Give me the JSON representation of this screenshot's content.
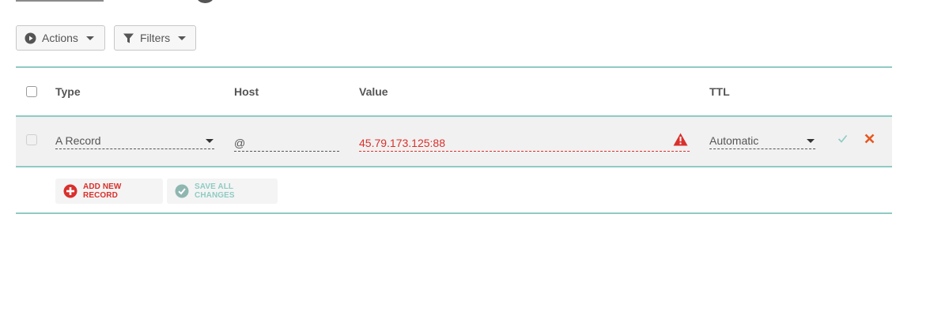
{
  "toolbar": {
    "actions_label": "Actions",
    "filters_label": "Filters"
  },
  "table": {
    "headers": {
      "type": "Type",
      "host": "Host",
      "value": "Value",
      "ttl": "TTL"
    },
    "edit_row": {
      "type": "A Record",
      "host": "@",
      "value": "45.79.173.125:88",
      "ttl": "Automatic"
    },
    "buttons": {
      "add_new_record": "ADD NEW RECORD",
      "save_all_changes": "SAVE ALL CHANGES"
    }
  },
  "colors": {
    "accent_teal": "#8fcbc3",
    "error_red": "#d9302c",
    "cancel_orange": "#e8571e"
  }
}
